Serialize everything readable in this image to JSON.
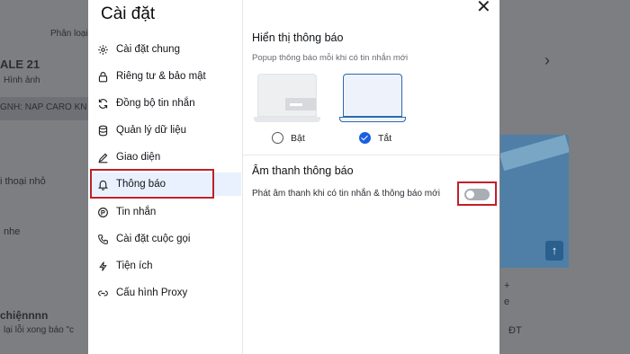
{
  "background": {
    "tab_label": "Phân loại",
    "product_code": "ALE 21",
    "images_label": "Hình ảnh",
    "banner_text": "GNH: NAP CARO KN",
    "phone_text": "i thoại nhỏ",
    "nhe_text": "nhe",
    "chien_text": "chiệnnnn",
    "error_text": "lại lỗi xong báo \"c",
    "dt_text": "ĐT",
    "plus_text": "+",
    "e_text": "e",
    "brand_color": "#4f7fa6"
  },
  "modal": {
    "title": "Cài đặt",
    "close_symbol": "✕",
    "menu": [
      {
        "label": "Cài đặt chung",
        "icon": "gear-icon"
      },
      {
        "label": "Riêng tư & bảo mật",
        "icon": "lock-icon"
      },
      {
        "label": "Đồng bộ tin nhắn",
        "icon": "sync-icon"
      },
      {
        "label": "Quản lý dữ liệu",
        "icon": "database-icon"
      },
      {
        "label": "Giao diện",
        "icon": "palette-icon"
      },
      {
        "label": "Thông báo",
        "icon": "bell-icon",
        "active": true
      },
      {
        "label": "Tin nhắn",
        "icon": "message-icon"
      },
      {
        "label": "Cài đặt cuộc gọi",
        "icon": "phone-icon"
      },
      {
        "label": "Tiện ích",
        "icon": "utility-icon"
      },
      {
        "label": "Cấu hình Proxy",
        "icon": "proxy-icon"
      }
    ],
    "accent_color": "#1a5fe0",
    "active_bg": "#e8f1fd",
    "highlight_color": "#c0202a"
  },
  "notifications": {
    "display_title": "Hiển thị thông báo",
    "display_desc": "Popup thông báo mỗi khi có tin nhắn mới",
    "options": [
      {
        "label": "Bật",
        "checked": false
      },
      {
        "label": "Tắt",
        "checked": true
      }
    ],
    "sound_title": "Âm thanh thông báo",
    "sound_desc": "Phát âm thanh khi có tin nhắn & thông báo mới",
    "sound_enabled": false
  }
}
